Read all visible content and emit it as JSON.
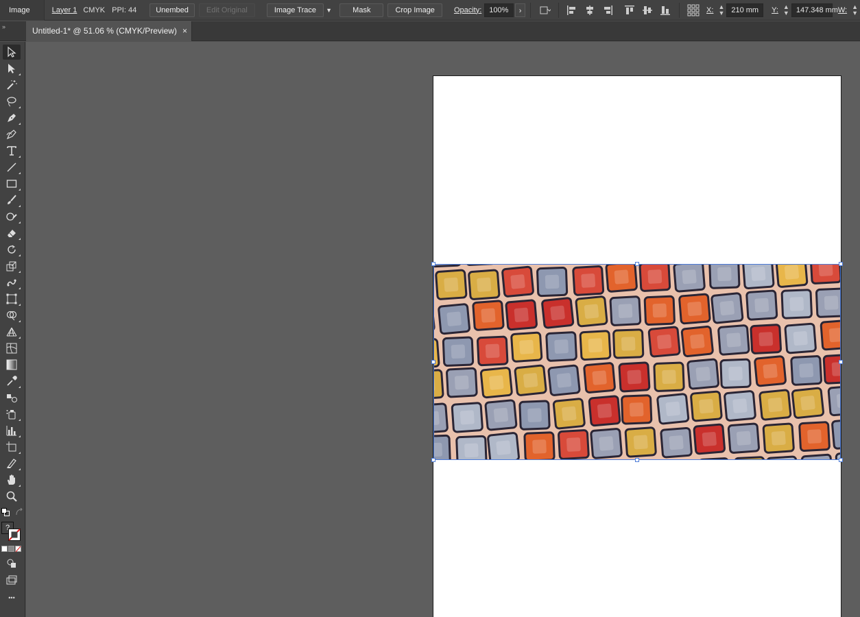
{
  "control_bar": {
    "context_label": "Image",
    "layer_name": "Layer 1",
    "color_mode": "CMYK",
    "ppi": "PPI: 44",
    "unembed_label": "Unembed",
    "edit_original_label": "Edit Original",
    "image_trace_label": "Image Trace",
    "mask_label": "Mask",
    "crop_image_label": "Crop Image",
    "opacity_label": "Opacity:",
    "opacity_value": "100%",
    "x_label": "X:",
    "x_value": "210 mm",
    "y_label": "Y:",
    "y_value": "147.348 mm",
    "w_label": "W:"
  },
  "document": {
    "tab_title": "Untitled-1* @ 51.06 % (CMYK/Preview)",
    "close_glyph": "×"
  },
  "tools": [
    {
      "name": "selection-tool",
      "active": true
    },
    {
      "name": "direct-selection-tool"
    },
    {
      "name": "magic-wand-tool"
    },
    {
      "name": "lasso-tool"
    },
    {
      "name": "pen-tool"
    },
    {
      "name": "curvature-tool"
    },
    {
      "name": "type-tool"
    },
    {
      "name": "line-segment-tool"
    },
    {
      "name": "rectangle-tool"
    },
    {
      "name": "paintbrush-tool"
    },
    {
      "name": "shaper-tool"
    },
    {
      "name": "eraser-tool"
    },
    {
      "name": "rotate-tool"
    },
    {
      "name": "scale-tool"
    },
    {
      "name": "puppet-warp-tool"
    },
    {
      "name": "free-transform-tool"
    },
    {
      "name": "shape-builder-tool"
    },
    {
      "name": "perspective-grid-tool"
    },
    {
      "name": "mesh-tool"
    },
    {
      "name": "gradient-tool"
    },
    {
      "name": "eyedropper-tool"
    },
    {
      "name": "blend-tool"
    },
    {
      "name": "symbol-sprayer-tool"
    },
    {
      "name": "column-graph-tool"
    },
    {
      "name": "artboard-tool"
    },
    {
      "name": "slice-tool"
    },
    {
      "name": "hand-tool"
    },
    {
      "name": "zoom-tool"
    }
  ],
  "toolbar_bottom": {
    "fill_stroke_unknown": "?",
    "more_tools": "•••"
  },
  "colors": {
    "selection": "#4c7bd8",
    "ui_panel": "#424242",
    "canvas": "#5e5e5e"
  }
}
